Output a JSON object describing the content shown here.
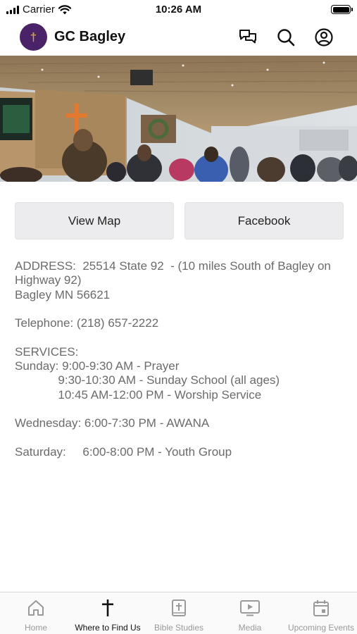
{
  "status_bar": {
    "carrier": "Carrier",
    "time": "10:26 AM"
  },
  "header": {
    "logo_glyph": "†",
    "title": "GC Bagley",
    "icons": [
      "chat-icon",
      "search-icon",
      "account-icon"
    ]
  },
  "hero": {
    "image": "church-service-photo"
  },
  "actions": {
    "view_map": "View Map",
    "facebook": "Facebook"
  },
  "info": {
    "address_line1": "ADDRESS:  25514 State 92  - (10 miles South of Bagley on",
    "address_line2": "Highway 92)",
    "address_line3": "Bagley MN 56621",
    "telephone": "Telephone: (218) 657-2222",
    "services_heading": "SERVICES:",
    "sunday_1": "Sunday: 9:00-9:30 AM - Prayer",
    "sunday_2": "             9:30-10:30 AM - Sunday School (all ages)",
    "sunday_3": "             10:45 AM-12:00 PM - Worship Service",
    "wednesday": "Wednesday: 6:00-7:30 PM - AWANA",
    "saturday": "Saturday:     6:00-8:00 PM - Youth Group"
  },
  "tabs": [
    {
      "label": "Home",
      "icon": "home-icon",
      "active": false
    },
    {
      "label": "Where to Find Us",
      "icon": "cross-icon",
      "active": true
    },
    {
      "label": "Bible Studies",
      "icon": "bible-icon",
      "active": false
    },
    {
      "label": "Media",
      "icon": "media-icon",
      "active": false
    },
    {
      "label": "Upcoming Events",
      "icon": "calendar-icon",
      "active": false
    }
  ],
  "colors": {
    "logo_bg": "#4a2268",
    "button_bg": "#ececee",
    "info_text": "#6b6b6b",
    "tab_inactive": "#9a9a9a"
  }
}
